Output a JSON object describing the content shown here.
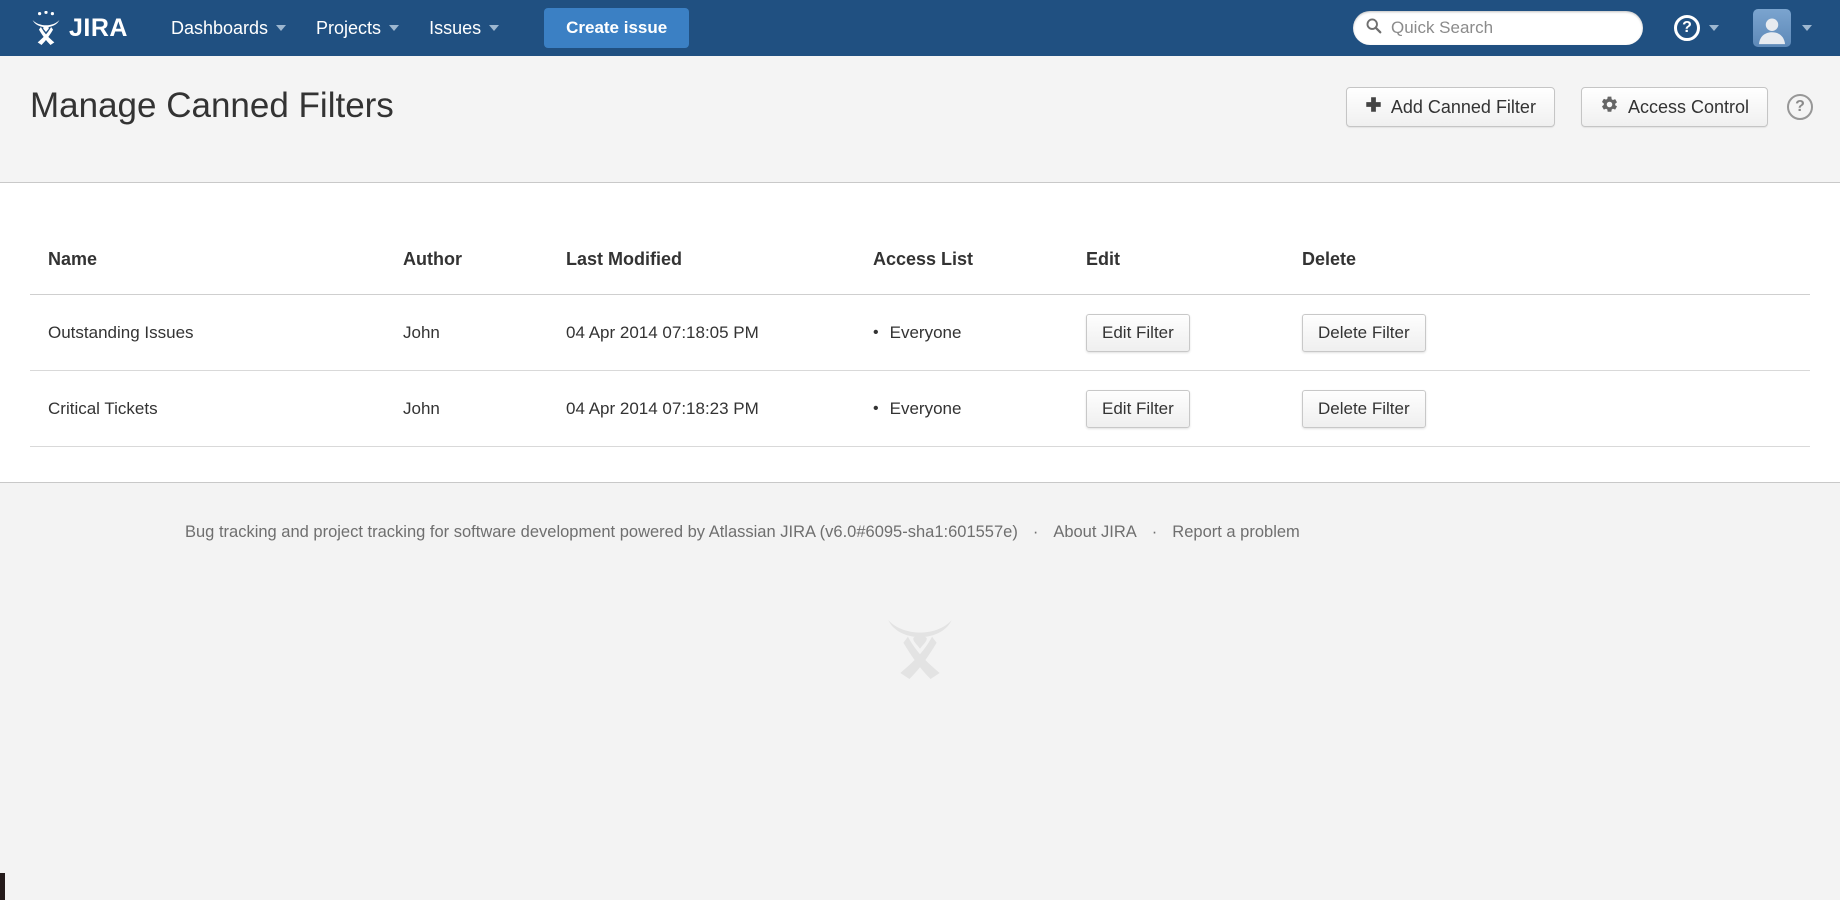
{
  "navbar": {
    "brand": "JIRA",
    "items": [
      {
        "label": "Dashboards"
      },
      {
        "label": "Projects"
      },
      {
        "label": "Issues"
      }
    ],
    "create_label": "Create issue",
    "search_placeholder": "Quick Search",
    "help_glyph": "?"
  },
  "page": {
    "title": "Manage Canned Filters",
    "add_button_label": "Add Canned Filter",
    "access_button_label": "Access Control",
    "help_glyph": "?"
  },
  "table": {
    "headers": [
      "Name",
      "Author",
      "Last Modified",
      "Access List",
      "Edit",
      "Delete"
    ],
    "bullet": "•",
    "rows": [
      {
        "name": "Outstanding Issues",
        "author": "John",
        "modified": "04 Apr 2014 07:18:05 PM",
        "access": "Everyone",
        "edit_label": "Edit Filter",
        "delete_label": "Delete Filter"
      },
      {
        "name": "Critical Tickets",
        "author": "John",
        "modified": "04 Apr 2014 07:18:23 PM",
        "access": "Everyone",
        "edit_label": "Edit Filter",
        "delete_label": "Delete Filter"
      }
    ]
  },
  "footer": {
    "text": "Bug tracking and project tracking for software development powered by Atlassian JIRA (v6.0#6095-sha1:601557e)",
    "separator": "·",
    "links": [
      "About JIRA",
      "Report a problem"
    ]
  },
  "icons": {
    "logo": "atlassian-charlie",
    "search": "magnifier",
    "help": "question-circle",
    "user": "person-silhouette",
    "add": "plus",
    "access": "gear"
  },
  "colors": {
    "navbar_bg": "#205081",
    "create_button_bg": "#3b80c4",
    "page_header_bg": "#f4f4f4",
    "content_bg": "#ffffff",
    "footer_bg": "#f3f3f3",
    "text": "#333333",
    "footer_text": "#6f6f6f",
    "border": "#cccccc",
    "watermark": "#e3e3e3"
  }
}
